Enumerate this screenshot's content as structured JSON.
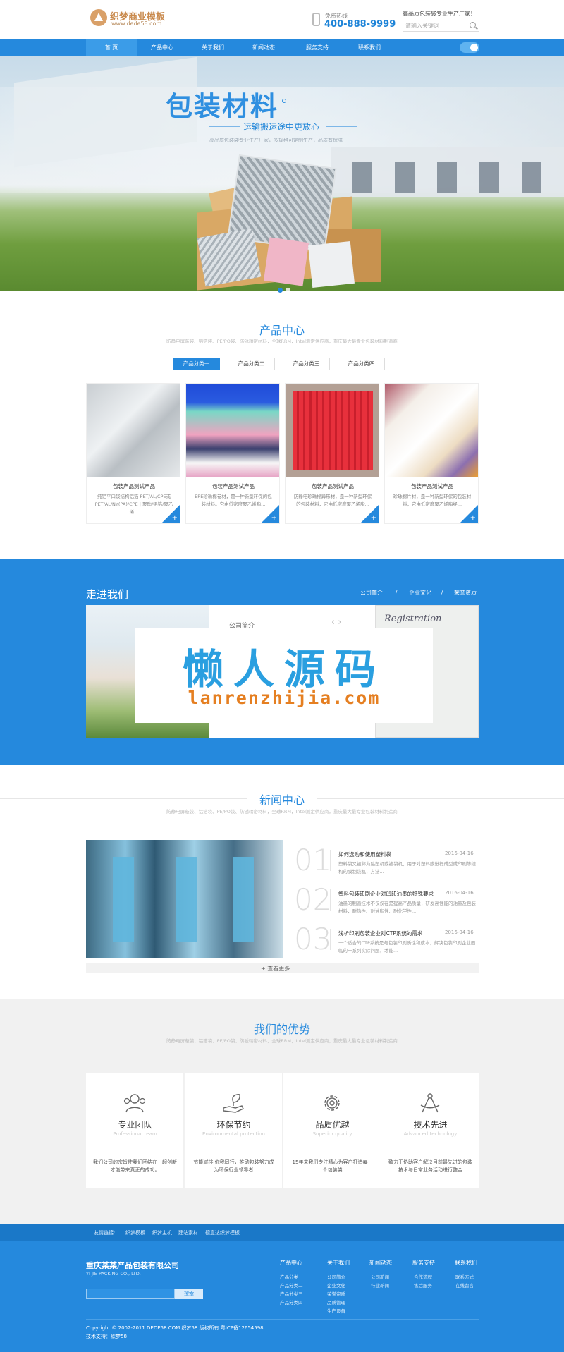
{
  "header": {
    "logo_title": "织梦商业模板",
    "logo_sub": "www.dede58.com",
    "hotline_label": "免费热线",
    "hotline": "400-888-9999",
    "slogan": "高品质包装袋专业生产厂家！",
    "search_placeholder": "请输入关键词"
  },
  "nav": [
    "首 页",
    "产品中心",
    "关于我们",
    "新闻动态",
    "服务支持",
    "联系我们"
  ],
  "banner": {
    "title": "包装材料",
    "subtitle": "运输搬运途中更放心",
    "desc": "高品质包装袋专业生产厂家，多规格可定制生产，品质有保障"
  },
  "products": {
    "title": "产品中心",
    "desc": "防静电屏蔽袋、铝箔袋、PE/PO袋、防锈精密材料，全球RRM，Intel测定供应商，重庆最大最专业包装材料制造商",
    "tabs": [
      "产品分类一",
      "产品分类二",
      "产品分类三",
      "产品分类四"
    ],
    "cards": [
      {
        "title": "包装产品测试产品",
        "text": "纯铝平口袋结构铝箔 PET/AL/CPE或PET/AL/NY(PA)/CPE | 聚酯/铝箔/聚乙烯..."
      },
      {
        "title": "包装产品测试产品",
        "text": "EPE珍珠棉卷材，是一种新型环保的包装材料。它由低密度聚乙烯脂..."
      },
      {
        "title": "包装产品测试产品",
        "text": "防静电珍珠棉异形材，是一种新型环保的包装材料，它由低密度聚乙烯脂..."
      },
      {
        "title": "包装产品测试产品",
        "text": "珍珠棉片材，是一种新型环保的包装材料，它由低密度聚乙烯脂经..."
      }
    ],
    "plus": "+"
  },
  "about": {
    "title": "走进我们",
    "tabs": [
      "公司简介",
      "企业文化",
      "荣誉资质"
    ],
    "sep": "/",
    "sub": "公司简介",
    "arrows": "‹  ›",
    "cert": "Registration",
    "watermark_cn": "懒人源码",
    "watermark_en": "lanrenzhijia.com"
  },
  "news": {
    "title": "新闻中心",
    "desc": "防静电屏蔽袋、铝箔袋、PE/PO袋、防锈精密材料，全球RRM，Intel测定供应商，重庆最大最专业包装材料制造商",
    "items": [
      {
        "num": "01",
        "title": "如何选购和使用塑料袋",
        "date": "2016-04-16",
        "text": "塑料袋又被称为贴塑机或被袋机，用于对塑料膜进行成型或印刷等结构的膜制袋机，方法..."
      },
      {
        "num": "02",
        "title": "塑料包装印刷企业对凹印油墨的特殊要求",
        "date": "2016-04-16",
        "text": "油墨的制造技术不仅仅在是提高产品质量，研发高性能的油墨及包装材料，耐热性、耐油脂性、耐化学性..."
      },
      {
        "num": "03",
        "title": "浅析印刷包装企业对CTP系统的需求",
        "date": "2016-04-16",
        "text": "一个适合的CTP系统是与包装印刷质性和成本，解决包装印刷企业面临的一系列实际问题，才能..."
      }
    ],
    "more": "+ 查看更多"
  },
  "advantages": {
    "title": "我们的优势",
    "desc": "防静电屏蔽袋、铝箔袋、PE/PO袋、防锈精密材料，全球RRM，Intel测定供应商，重庆最大最专业包装材料制造商",
    "items": [
      {
        "title": "专业团队",
        "en": "Professional team",
        "text": "我们公司的宗旨使我们团结在一起创新才能带来真正的成功。",
        "icon": "team-icon"
      },
      {
        "title": "环保节约",
        "en": "Environmental protection",
        "text": "节能减排 你我同行，推动包装努力成为环保行业领导者",
        "icon": "leaf-hand-icon"
      },
      {
        "title": "品质优越",
        "en": "Superior quality",
        "text": "15年来我们专注精心为客户打造每一个包装袋",
        "icon": "gear-icon"
      },
      {
        "title": "技术先进",
        "en": "Advanced technology",
        "text": "致力于协助客户解决目前最先进的包装技术与日常业务活动进行整合",
        "icon": "compass-icon"
      }
    ]
  },
  "footer": {
    "links_label": "友情链接:",
    "links": [
      "织梦模板",
      "织梦主机",
      "建站素材",
      "德意达织梦模板"
    ],
    "company": "重庆某某产品包装有限公司",
    "company_en": "YI JIE PACKING CO., LTD.",
    "search_btn": "搜索",
    "columns": [
      {
        "title": "产品中心",
        "items": [
          "产品分类一",
          "产品分类二",
          "产品分类三",
          "产品分类四"
        ]
      },
      {
        "title": "关于我们",
        "items": [
          "公司简介",
          "企业文化",
          "荣誉资质",
          "品质管理",
          "生产设备"
        ]
      },
      {
        "title": "新闻动态",
        "items": [
          "公司新闻",
          "行业新闻"
        ]
      },
      {
        "title": "服务支持",
        "items": [
          "合作流程",
          "售后服务"
        ]
      },
      {
        "title": "联系我们",
        "items": [
          "联系方式",
          "在线留言"
        ]
      }
    ],
    "copyright": "Copyright © 2002-2011 DEDE58.COM 织梦58 版权所有 粤ICP备12654598",
    "tech": "技术支持：织梦58"
  }
}
